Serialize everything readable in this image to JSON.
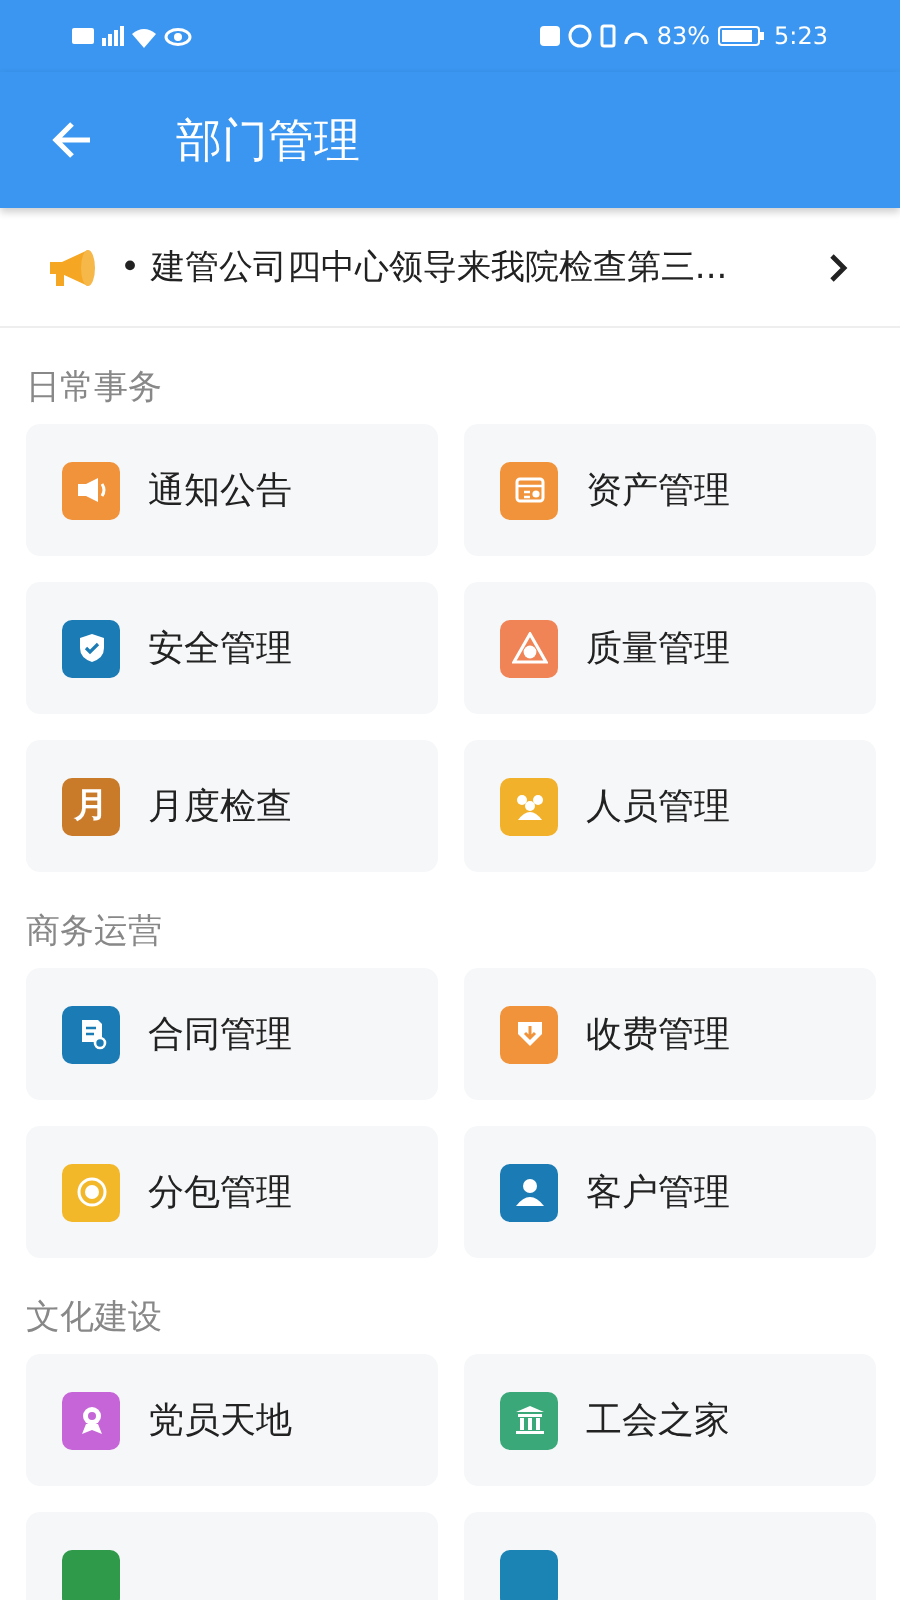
{
  "status_bar": {
    "battery_percent": "83%",
    "time": "5:23"
  },
  "header": {
    "title": "部门管理"
  },
  "notice": {
    "text": "• 建管公司四中心领导来我院检查第三..."
  },
  "sections": [
    {
      "title": "日常事务",
      "items": [
        {
          "label": "通知公告",
          "color": "#f0933a"
        },
        {
          "label": "资产管理",
          "color": "#f0933a"
        },
        {
          "label": "安全管理",
          "color": "#1b7bb5"
        },
        {
          "label": "质量管理",
          "color": "#f08456"
        },
        {
          "label": "月度检查",
          "color": "#c97b2a",
          "glyph": "月"
        },
        {
          "label": "人员管理",
          "color": "#f2b12a"
        }
      ]
    },
    {
      "title": "商务运营",
      "items": [
        {
          "label": "合同管理",
          "color": "#1b7bb5"
        },
        {
          "label": "收费管理",
          "color": "#f0933a"
        },
        {
          "label": "分包管理",
          "color": "#f2b82a"
        },
        {
          "label": "客户管理",
          "color": "#1b7bb5"
        }
      ]
    },
    {
      "title": "文化建设",
      "items": [
        {
          "label": "党员天地",
          "color": "#c565d8"
        },
        {
          "label": "工会之家",
          "color": "#3aa878"
        },
        {
          "color": "#2e9a4a"
        },
        {
          "color": "#1b84b5"
        }
      ]
    }
  ]
}
